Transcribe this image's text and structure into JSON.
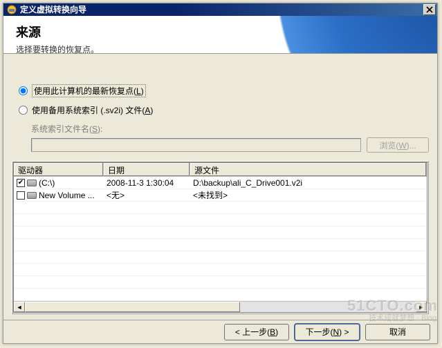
{
  "title": "定义虚拟转换向导",
  "banner": {
    "heading": "来源",
    "sub": "选择要转换的恢复点。"
  },
  "options": {
    "use_latest": {
      "label": "使用此计算机的最新恢复点(",
      "hotkey": "L",
      "suffix": ")"
    },
    "use_index": {
      "label": "使用备用系统索引 (.sv2i) 文件(",
      "hotkey": "A",
      "suffix": ")"
    },
    "index_path_label": {
      "text": "系统索引文件名(",
      "hotkey": "S",
      "suffix": "):"
    },
    "browse_label": {
      "text": "浏览(",
      "hotkey": "W",
      "suffix": ")..."
    }
  },
  "columns": {
    "drive": "驱动器",
    "date": "日期",
    "source": "源文件"
  },
  "rows": [
    {
      "checked": true,
      "name": "(C:\\)",
      "date": "2008-11-3 1:30:04",
      "source": "D:\\backup\\ali_C_Drive001.v2i"
    },
    {
      "checked": false,
      "name": "New Volume ...",
      "date": "<无>",
      "source": "<未找到>"
    }
  ],
  "buttons": {
    "back": {
      "text": "< 上一步(",
      "hotkey": "B",
      "suffix": ")"
    },
    "next": {
      "text": "下一步(",
      "hotkey": "N",
      "suffix": ") >"
    },
    "cancel": "取消"
  },
  "watermark": "51CTO.com",
  "watermark_sub": "技术成就梦想 · Blog"
}
